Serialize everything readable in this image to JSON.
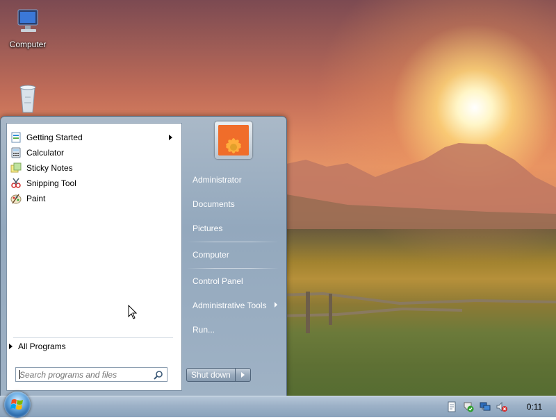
{
  "desktop": {
    "icons": [
      {
        "label": "Computer",
        "icon": "computer-icon"
      },
      {
        "label": "",
        "icon": "recycle-bin-icon"
      }
    ]
  },
  "start_menu": {
    "programs": [
      {
        "label": "Getting Started",
        "icon": "getting-started-icon",
        "has_submenu": true
      },
      {
        "label": "Calculator",
        "icon": "calculator-icon"
      },
      {
        "label": "Sticky Notes",
        "icon": "sticky-notes-icon"
      },
      {
        "label": "Snipping Tool",
        "icon": "snipping-tool-icon"
      },
      {
        "label": "Paint",
        "icon": "paint-icon"
      }
    ],
    "all_programs_label": "All Programs",
    "search": {
      "placeholder": "Search programs and files",
      "value": ""
    },
    "right_items": [
      {
        "label": "Administrator"
      },
      {
        "label": "Documents"
      },
      {
        "label": "Pictures"
      },
      {
        "label": "Computer"
      },
      {
        "label": "Control Panel"
      },
      {
        "label": "Administrative Tools",
        "has_submenu": true
      },
      {
        "label": "Run..."
      }
    ],
    "shutdown_label": "Shut down"
  },
  "taskbar": {
    "clock": "0:11",
    "tray_icons": [
      "notes-icon",
      "action-center-icon",
      "network-icon",
      "volume-muted-icon"
    ]
  }
}
